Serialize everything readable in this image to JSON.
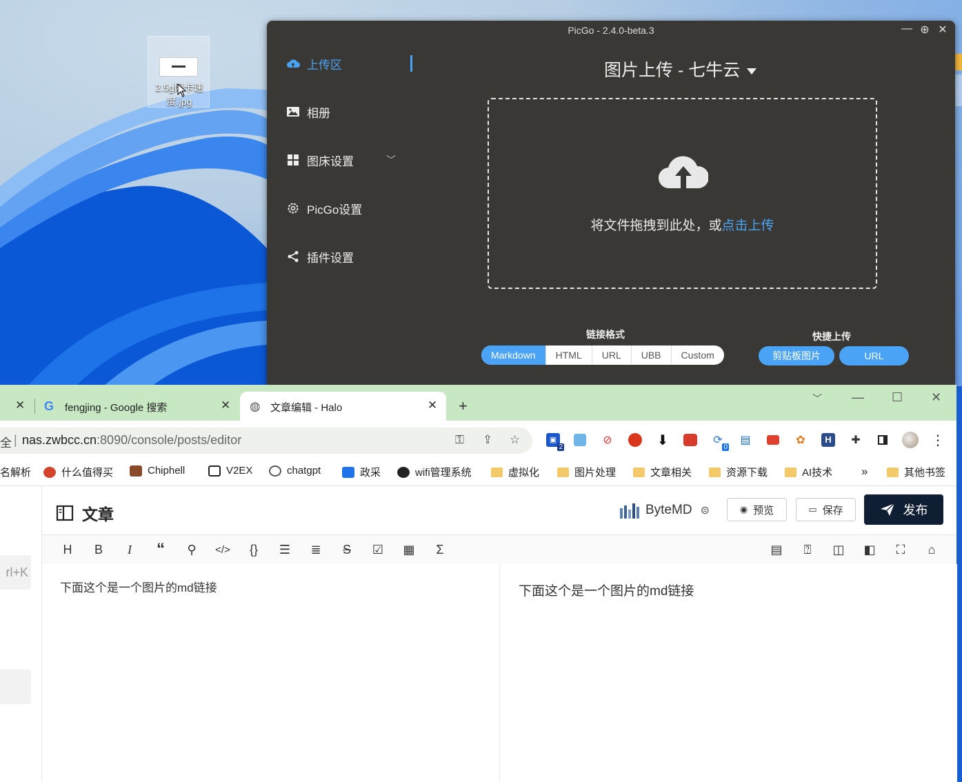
{
  "desktop": {
    "file_icon_label": "2.5g网卡速度.jpg"
  },
  "picgo": {
    "window_title": "PicGo - 2.4.0-beta.3",
    "nav": [
      {
        "label": "上传区",
        "icon": "cloud-upload-icon"
      },
      {
        "label": "相册",
        "icon": "image-icon"
      },
      {
        "label": "图床设置",
        "icon": "grid-icon"
      },
      {
        "label": "PicGo设置",
        "icon": "gear-icon"
      },
      {
        "label": "插件设置",
        "icon": "share-icon"
      }
    ],
    "title": "图片上传 - 七牛云",
    "dropzone_text": "将文件拖拽到此处，或",
    "dropzone_link": "点击上传",
    "link_format_label": "链接格式",
    "link_formats": [
      "Markdown",
      "HTML",
      "URL",
      "UBB",
      "Custom"
    ],
    "selected_format": "Markdown",
    "quick_upload_label": "快捷上传",
    "quick_buttons": [
      "剪贴板图片",
      "URL"
    ]
  },
  "browser": {
    "tabs": [
      {
        "title": "fengjing - Google 搜索"
      },
      {
        "title": "文章编辑 - Halo"
      }
    ],
    "address_prefix": "全",
    "url_host": "nas.zwbcc.cn",
    "url_rest": ":8090/console/posts/editor",
    "ext_badges": [
      "2",
      "0"
    ],
    "bookmarks": [
      "名解析",
      "什么值得买",
      "Chiphell",
      "V2EX",
      "chatgpt",
      "政采",
      "wifi管理系统",
      "虚拟化",
      "图片处理",
      "文章相关",
      "资源下载",
      "AI技术",
      "其他书签"
    ],
    "bookmarks_more": "»"
  },
  "halo": {
    "sidebar_hint": "rl+K",
    "page_title": "文章",
    "editor_name": "ByteMD",
    "preview_button": "预览",
    "save_button": "保存",
    "publish_button": "发布",
    "editor_content": "下面这个是一个图片的md链接",
    "preview_content": "下面这个是一个图片的md链接"
  },
  "colors": {
    "picgo_bg": "#3a3835",
    "picgo_accent": "#4aa3f5",
    "tabstrip_bg": "#c8e8c4",
    "publish_bg": "#0f1e33"
  }
}
